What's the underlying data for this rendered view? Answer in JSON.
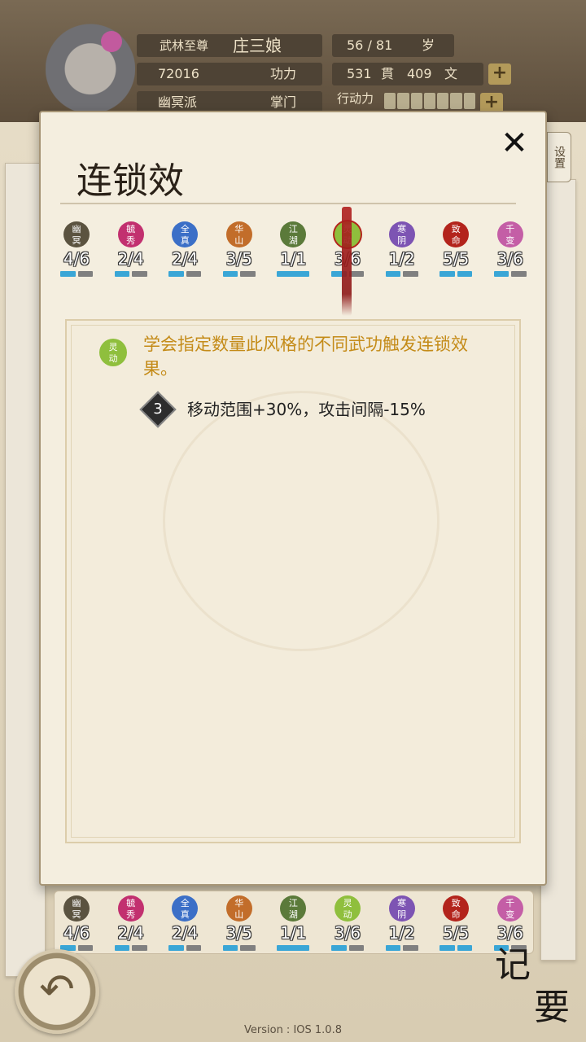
{
  "header": {
    "title_rank": "武林至尊",
    "name": "庄三娘",
    "age": "56 / 81",
    "age_unit": "岁",
    "power_value": "72016",
    "power_label": "功力",
    "money_guan": "531",
    "money_guan_unit": "貫",
    "money_wen": "409",
    "money_wen_unit": "文",
    "sect": "幽冥派",
    "position": "掌门",
    "stamina_label": "行动力",
    "plus_label": "+"
  },
  "settings_tab": "设置",
  "panel": {
    "title": "连锁效",
    "close": "✕",
    "tabs": [
      {
        "label": "幽\n冥",
        "count": "4/6",
        "color": "#5b5340",
        "filled": 1
      },
      {
        "label": "毓\n秀",
        "count": "2/4",
        "color": "#c2306f",
        "filled": 1
      },
      {
        "label": "全\n真",
        "count": "2/4",
        "color": "#3b6fc7",
        "filled": 1
      },
      {
        "label": "华\n山",
        "count": "3/5",
        "color": "#c26d2a",
        "filled": 1
      },
      {
        "label": "江\n湖",
        "count": "1/1",
        "color": "#5b7a3a",
        "filled": 1
      },
      {
        "label": "灵\n动",
        "count": "3/6",
        "color": "#8fbf3d",
        "filled": 1,
        "active": true
      },
      {
        "label": "寒\n阴",
        "count": "1/2",
        "color": "#7d54b3",
        "filled": 1
      },
      {
        "label": "致\n命",
        "count": "5/5",
        "color": "#b3241c",
        "filled": 2
      },
      {
        "label": "千\n变",
        "count": "3/6",
        "color": "#c45ea6",
        "filled": 1
      }
    ],
    "detail": {
      "badge": "灵\n动",
      "description": "学会指定数量此风格的不同武功触发连锁效果。",
      "effect_number": "3",
      "effect_text": "移动范围+30%，攻击间隔-15%"
    }
  },
  "bottom_tabs": [
    {
      "label": "幽\n冥",
      "count": "4/6",
      "color": "#5b5340",
      "filled": 1
    },
    {
      "label": "毓\n秀",
      "count": "2/4",
      "color": "#c2306f",
      "filled": 1
    },
    {
      "label": "全\n真",
      "count": "2/4",
      "color": "#3b6fc7",
      "filled": 1
    },
    {
      "label": "华\n山",
      "count": "3/5",
      "color": "#c26d2a",
      "filled": 1
    },
    {
      "label": "江\n湖",
      "count": "1/1",
      "color": "#5b7a3a",
      "filled": 1
    },
    {
      "label": "灵\n动",
      "count": "3/6",
      "color": "#8fbf3d",
      "filled": 1
    },
    {
      "label": "寒\n阴",
      "count": "1/2",
      "color": "#7d54b3",
      "filled": 1
    },
    {
      "label": "致\n命",
      "count": "5/5",
      "color": "#b3241c",
      "filled": 2
    },
    {
      "label": "千\n变",
      "count": "3/6",
      "color": "#c45ea6",
      "filled": 1
    }
  ],
  "back_icon": "back-arrow-icon",
  "notes_label_1": "记",
  "notes_label_2": "要",
  "version": "Version : IOS 1.0.8"
}
